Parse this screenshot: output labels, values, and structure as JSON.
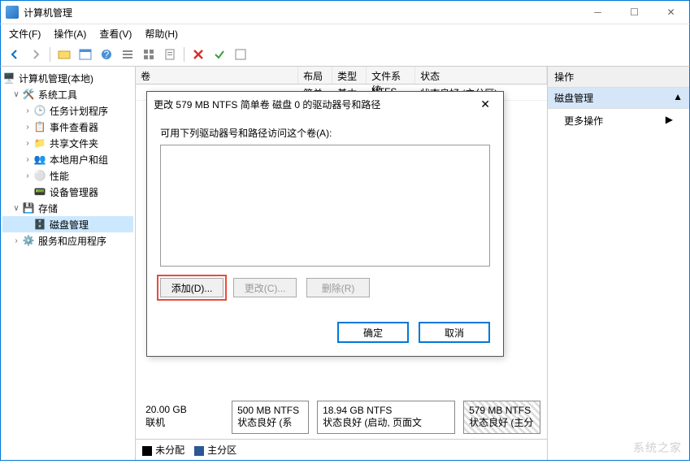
{
  "window": {
    "title": "计算机管理"
  },
  "menubar": {
    "file": "文件(F)",
    "action": "操作(A)",
    "view": "查看(V)",
    "help": "帮助(H)"
  },
  "tree": {
    "root": "计算机管理(本地)",
    "system_tools": "系统工具",
    "task_scheduler": "任务计划程序",
    "event_viewer": "事件查看器",
    "shared_folders": "共享文件夹",
    "local_users": "本地用户和组",
    "performance": "性能",
    "device_manager": "设备管理器",
    "storage": "存储",
    "disk_management": "磁盘管理",
    "services_apps": "服务和应用程序"
  },
  "list": {
    "headers": {
      "volume": "卷",
      "layout": "布局",
      "type": "类型",
      "filesystem": "文件系统",
      "status": "状态"
    },
    "row1": {
      "layout": "简单",
      "type": "基本",
      "filesystem": "NTFS",
      "status": "状态良好 (主分区)"
    }
  },
  "disk": {
    "size": "20.00 GB",
    "online": "联机",
    "p1": {
      "line1": "500 MB NTFS",
      "line2": "状态良好 (系"
    },
    "p2": {
      "line1": "18.94 GB NTFS",
      "line2": "状态良好 (启动, 页面文"
    },
    "p3": {
      "line1": "579 MB NTFS",
      "line2": "状态良好 (主分"
    }
  },
  "legend": {
    "unallocated": "未分配",
    "primary": "主分区"
  },
  "actions": {
    "header": "操作",
    "group": "磁盘管理",
    "more": "更多操作"
  },
  "dialog": {
    "title": "更改 579 MB NTFS 简单卷 磁盘 0 的驱动器号和路径",
    "prompt": "可用下列驱动器号和路径访问这个卷(A):",
    "add": "添加(D)...",
    "change": "更改(C)...",
    "remove": "删除(R)",
    "ok": "确定",
    "cancel": "取消"
  },
  "watermark": "系统之家"
}
